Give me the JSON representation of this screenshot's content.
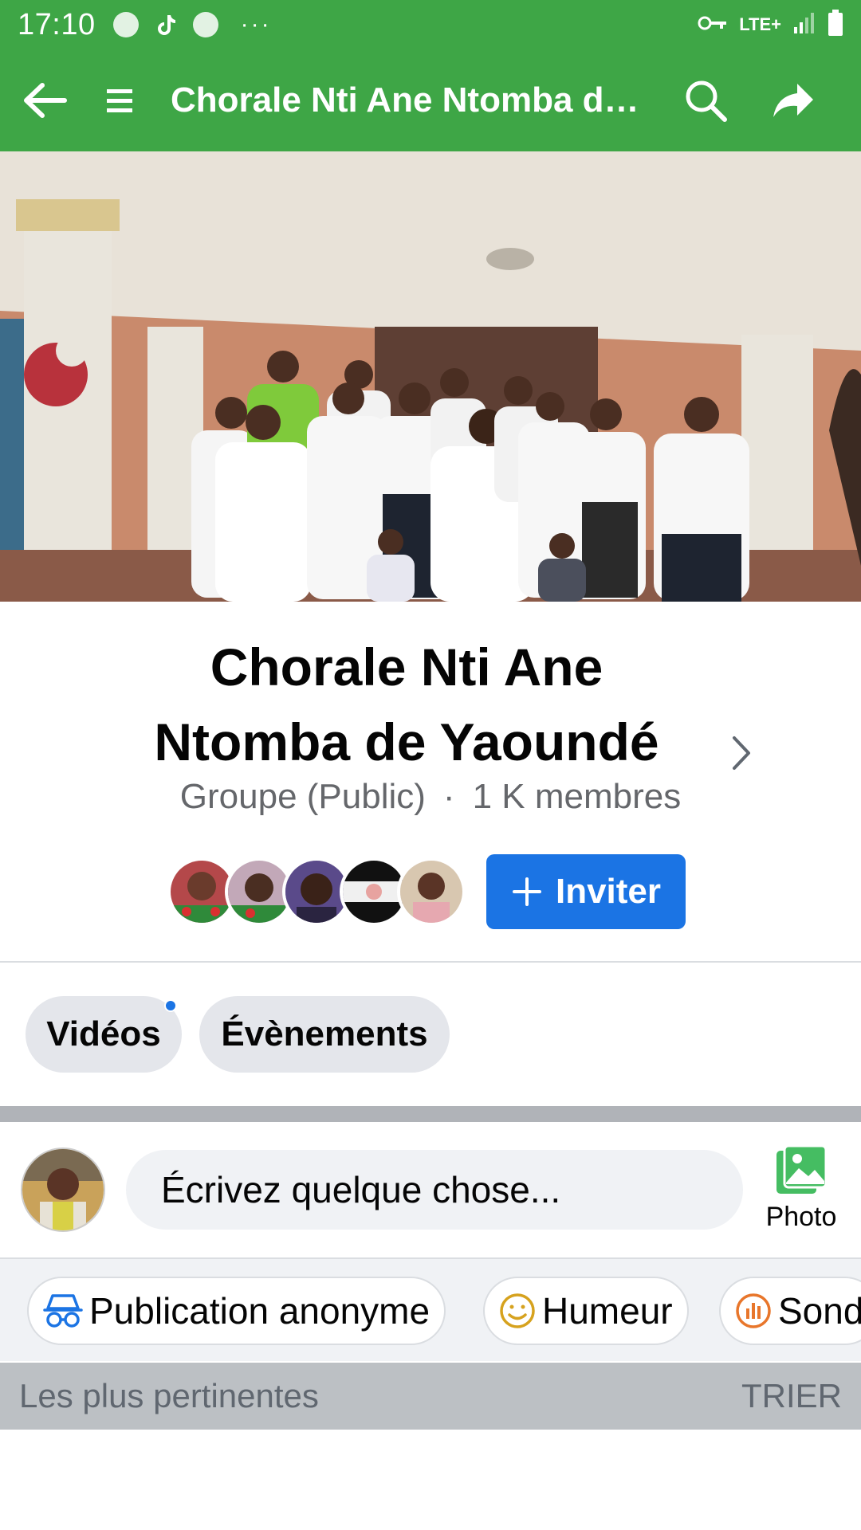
{
  "theme": {
    "brand": "#3ea646",
    "accent": "#1b74e4"
  },
  "status_bar": {
    "time": "17:10",
    "more": "···",
    "network": "LTE+",
    "icons": [
      "chrome-icon",
      "tiktok-icon",
      "chrome-icon",
      "vpn-key-icon",
      "signal-icon",
      "battery-icon"
    ]
  },
  "app_bar": {
    "title": "Chorale Nti Ane Ntomba de Yaoundé",
    "icons": [
      "back-arrow-icon",
      "menu-icon",
      "search-icon",
      "share-icon"
    ]
  },
  "group": {
    "name": "Chorale Nti Ane Ntomba de Yaoundé",
    "type": "Groupe (Public)",
    "separator": "·",
    "members": "1 K membres",
    "invite_label": "Inviter"
  },
  "chips": [
    {
      "label": "Vidéos",
      "has_new": true
    },
    {
      "label": "Évènements"
    }
  ],
  "composer": {
    "placeholder": "Écrivez quelque chose...",
    "photo_label": "Photo"
  },
  "actions": [
    {
      "label": "Publication anonyme",
      "icon": "anonymous-icon"
    },
    {
      "label": "Humeur",
      "icon": "smiley-icon"
    },
    {
      "label": "Sond",
      "icon": "poll-icon"
    }
  ],
  "sort": {
    "label": "Les plus pertinentes",
    "action": "TRIER"
  }
}
